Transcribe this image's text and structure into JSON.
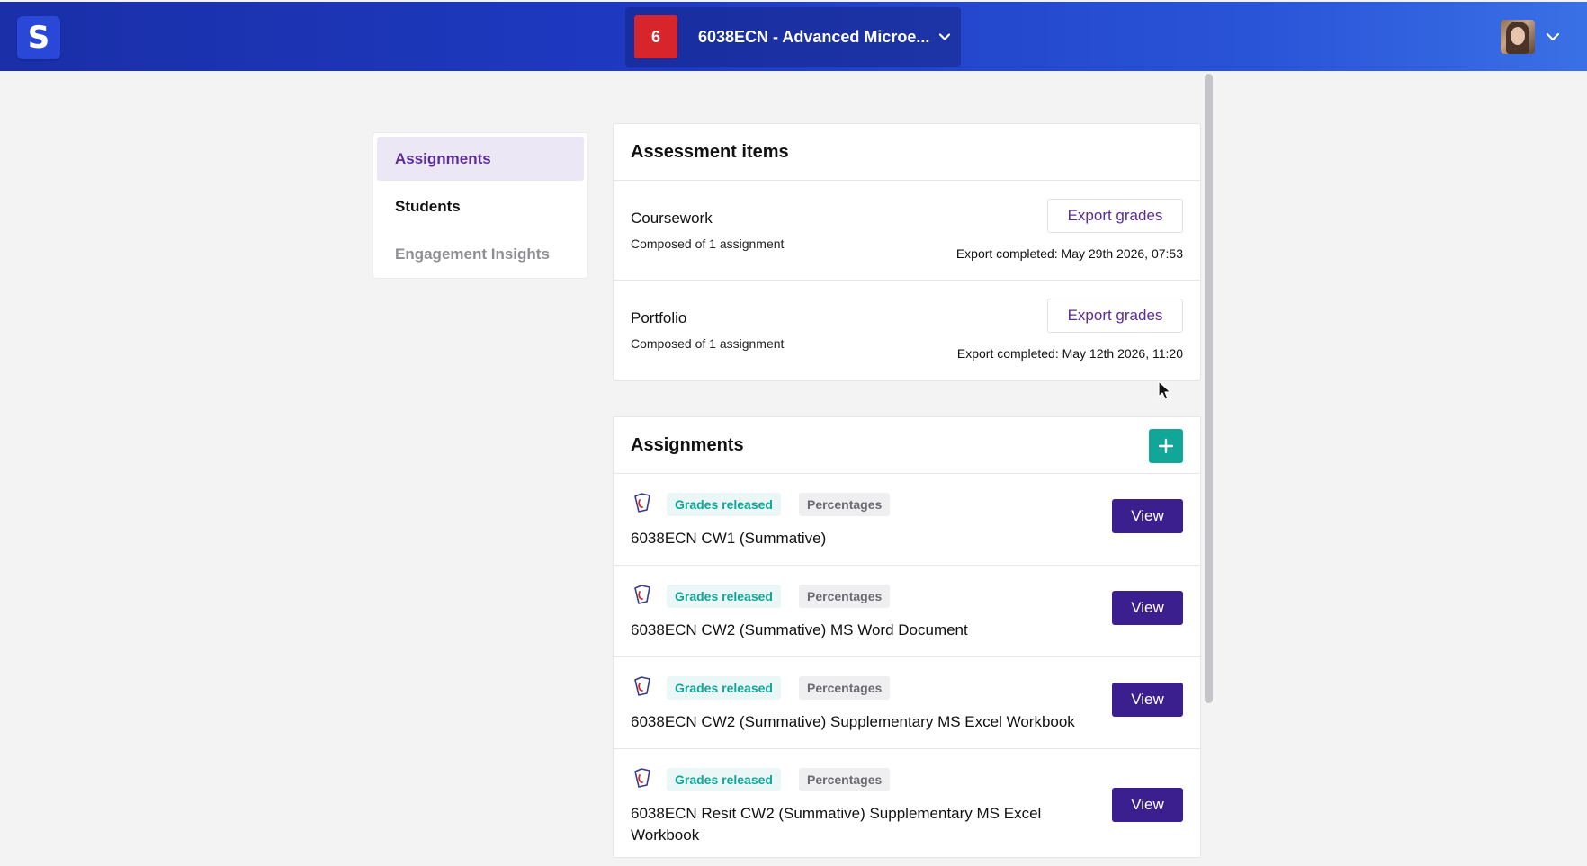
{
  "header": {
    "logo_letter": "S",
    "course_badge": "6",
    "course_title": "6038ECN - Advanced Microe..."
  },
  "sidebar": {
    "items": [
      {
        "label": "Assignments",
        "state": "active"
      },
      {
        "label": "Students",
        "state": "normal"
      },
      {
        "label": "Engagement Insights",
        "state": "muted"
      }
    ]
  },
  "assessment": {
    "title": "Assessment items",
    "items": [
      {
        "name": "Coursework",
        "sub": "Composed of 1 assignment",
        "button": "Export grades",
        "status": "Export completed: May 29th 2026, 07:53"
      },
      {
        "name": "Portfolio",
        "sub": "Composed of 1 assignment",
        "button": "Export grades",
        "status": "Export completed: May 12th 2026, 11:20"
      }
    ]
  },
  "assignments": {
    "title": "Assignments",
    "add_label": "+",
    "items": [
      {
        "tag_status": "Grades released",
        "tag_type": "Percentages",
        "title": "6038ECN CW1 (Summative)",
        "button": "View"
      },
      {
        "tag_status": "Grades released",
        "tag_type": "Percentages",
        "title": "6038ECN CW2 (Summative) MS Word Document",
        "button": "View"
      },
      {
        "tag_status": "Grades released",
        "tag_type": "Percentages",
        "title": "6038ECN CW2 (Summative) Supplementary MS Excel Workbook",
        "button": "View"
      },
      {
        "tag_status": "Grades released",
        "tag_type": "Percentages",
        "title": "6038ECN Resit CW2 (Summative) Supplementary MS Excel Workbook",
        "button": "View"
      }
    ]
  },
  "colors": {
    "brand_blue": "#1e3bc4",
    "accent_purple": "#3c1f8e",
    "teal": "#12a699",
    "badge_red": "#d8242b"
  }
}
